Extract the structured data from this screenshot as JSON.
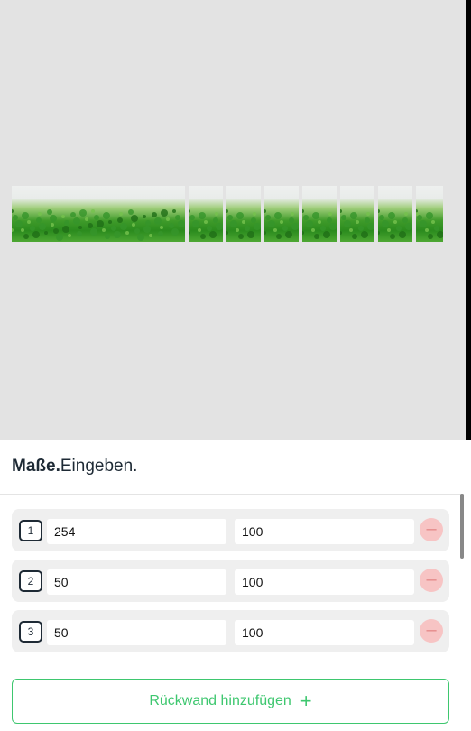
{
  "header": {
    "title_bold": "Maße.",
    "title_regular": "Eingeben."
  },
  "rows": [
    {
      "index": "1",
      "width": "254",
      "height": "100"
    },
    {
      "index": "2",
      "width": "50",
      "height": "100"
    },
    {
      "index": "3",
      "width": "50",
      "height": "100"
    }
  ],
  "add_button": {
    "label": "Rückwand hinzufügen",
    "icon": "plus-icon"
  },
  "colors": {
    "accent": "#3ec76f",
    "remove": "#f7c4c4"
  }
}
